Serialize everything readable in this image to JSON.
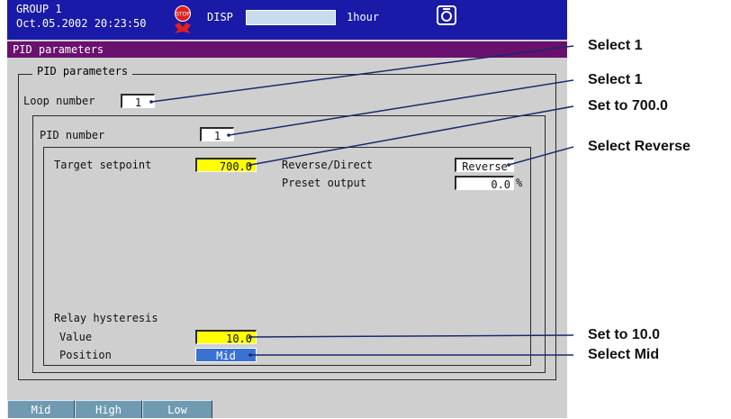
{
  "status": {
    "group": "GROUP 1",
    "datetime": "Oct.05.2002 20:23:50",
    "disp_label": "DISP",
    "interval": "1hour",
    "stop_icon_text": "STOP"
  },
  "title": "PID parameters",
  "section_title": "PID parameters",
  "loop": {
    "label": "Loop number",
    "value": "1"
  },
  "pid": {
    "label": "PID number",
    "value": "1"
  },
  "target": {
    "label": "Target setpoint",
    "value": "700.0"
  },
  "reverse_direct": {
    "label": "Reverse/Direct",
    "value": "Reverse"
  },
  "preset": {
    "label": "Preset output",
    "value": "0.0",
    "unit": "%"
  },
  "relay": {
    "title": "Relay hysteresis",
    "value_label": "Value",
    "value": "10.0",
    "position_label": "Position",
    "position": "Mid"
  },
  "softkeys": [
    "Mid",
    "High",
    "Low"
  ],
  "annotations": {
    "select_loop": "Select 1",
    "select_pid": "Select 1",
    "set_target": "Set to 700.0",
    "select_reverse": "Select Reverse",
    "set_hysteresis": "Set to 10.0",
    "select_mid": "Select Mid"
  },
  "colors": {
    "status_bar": "#1a1aa8",
    "title_bar": "#6a106e",
    "screen_bg": "#cfcfcf",
    "highlight_yellow": "#ffff00",
    "selected_blue": "#3a72d2",
    "softkey": "#6f9ab1"
  }
}
